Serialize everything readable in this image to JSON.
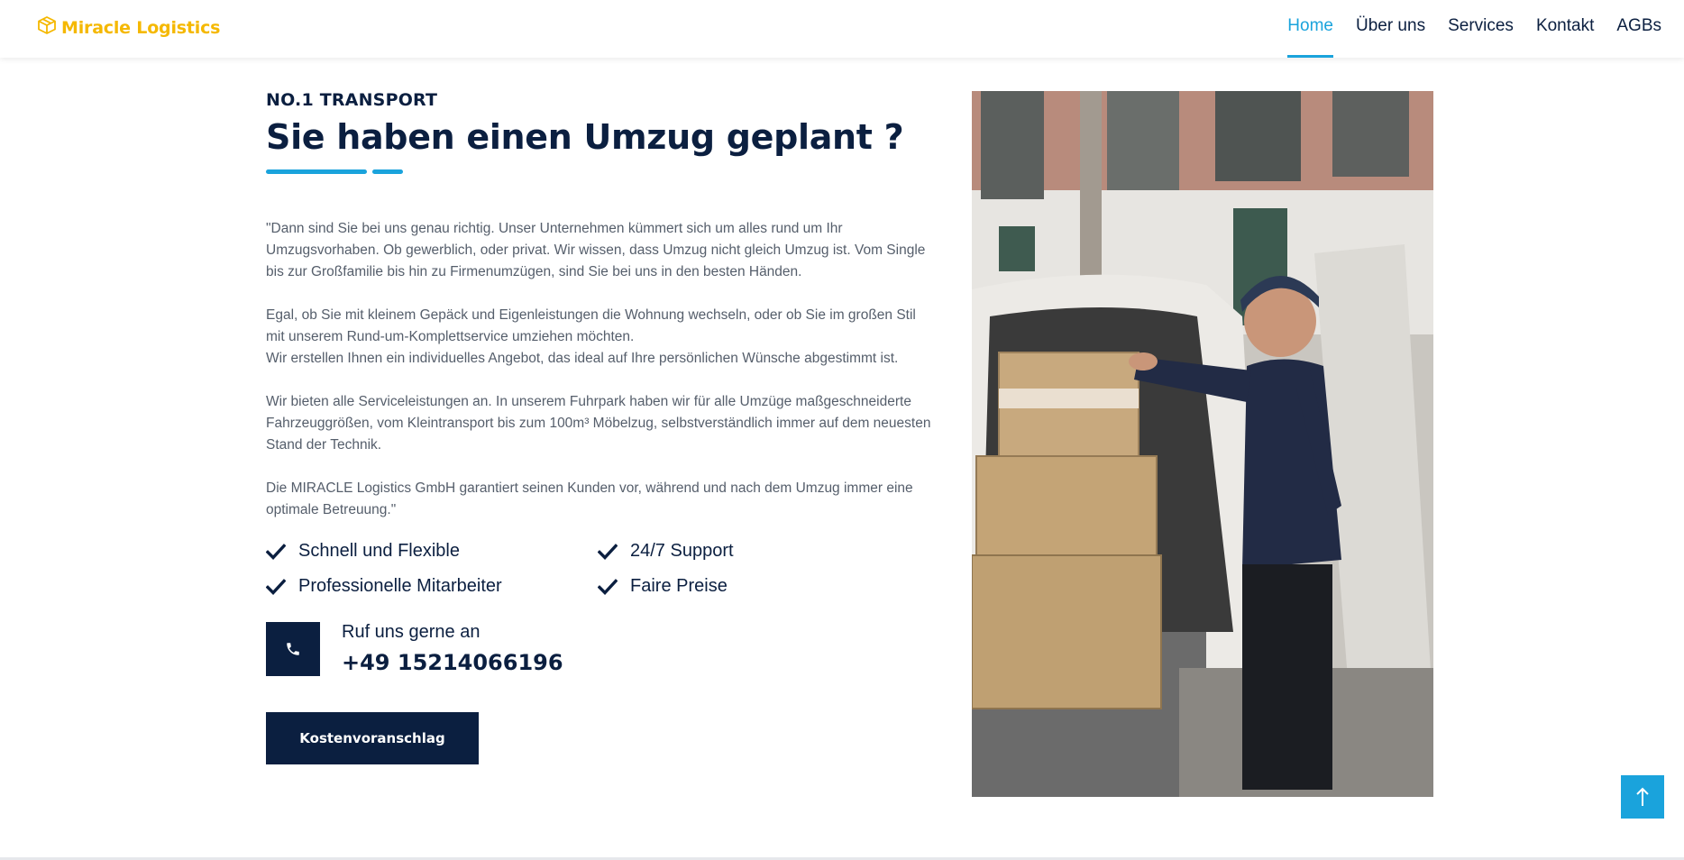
{
  "brand": {
    "name": "Miracle Logistics",
    "color": "#f5b800",
    "icon": "box-icon"
  },
  "nav": {
    "items": [
      {
        "label": "Home",
        "active": true
      },
      {
        "label": "Über uns",
        "active": false
      },
      {
        "label": "Services",
        "active": false
      },
      {
        "label": "Kontakt",
        "active": false
      },
      {
        "label": "AGBs",
        "active": false
      }
    ],
    "active_color": "#1aa3dc"
  },
  "hero": {
    "eyebrow": "NO.1 TRANSPORT",
    "title": "Sie haben einen Umzug geplant ?",
    "paragraphs": [
      "\"Dann sind Sie bei uns genau richtig. Unser Unternehmen kümmert sich um alles rund um Ihr Umzugsvorhaben. Ob gewerblich, oder privat. Wir wissen, dass Umzug nicht gleich Umzug ist. Vom Single bis zur Großfamilie bis hin zu Firmenumzügen, sind Sie bei uns in den besten Händen.",
      "Egal, ob Sie mit kleinem Gepäck und Eigenleistungen die Wohnung wechseln, oder ob Sie im großen Stil mit unserem Rund-um-Komplettservice umziehen möchten.",
      "Wir erstellen Ihnen ein individuelles Angebot, das ideal auf Ihre persönlichen Wünsche abgestimmt ist.",
      "Wir bieten alle Serviceleistungen an. In unserem Fuhrpark haben wir für alle Umzüge maßgeschneiderte Fahrzeuggrößen, vom Kleintransport bis zum 100m³ Möbelzug, selbstverständlich immer auf dem neuesten Stand der Technik.",
      "Die MIRACLE Logistics GmbH garantiert seinen Kunden vor, während und nach dem Umzug immer eine optimale Betreuung.\""
    ],
    "features": [
      "Schnell und Flexible",
      "24/7 Support",
      "Professionelle Mitarbeiter",
      "Faire Preise"
    ],
    "call": {
      "label": "Ruf uns gerne an",
      "number": "+49 15214066196",
      "icon": "phone-icon"
    },
    "cta_label": "Kostenvoranschlag"
  },
  "colors": {
    "navy": "#0b1f40",
    "accent": "#1aa3dc"
  },
  "back_to_top_icon": "arrow-up-icon"
}
